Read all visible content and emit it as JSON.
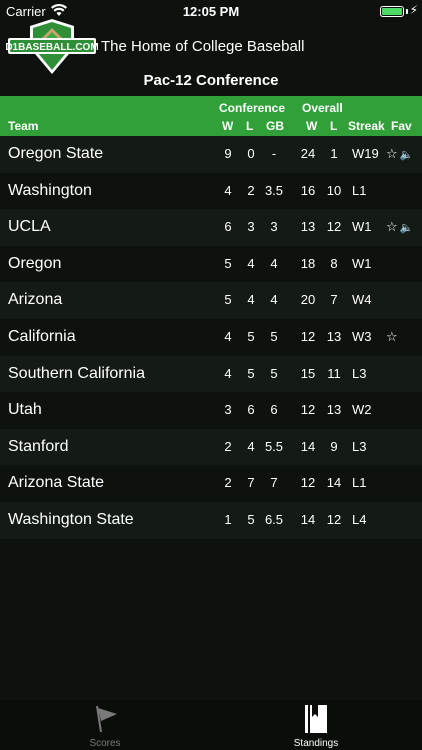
{
  "status_bar": {
    "carrier": "Carrier",
    "time": "12:05 PM",
    "battery_level": 1.0
  },
  "header": {
    "logo_text": "D1BASEBALL.COM",
    "tagline": "The Home of College Baseball",
    "conference_title": "Pac-12 Conference"
  },
  "columns": {
    "group_conference": "Conference",
    "group_overall": "Overall",
    "team": "Team",
    "conf_w": "W",
    "conf_l": "L",
    "gb": "GB",
    "overall_w": "W",
    "overall_l": "L",
    "streak": "Streak",
    "fav": "Fav"
  },
  "standings": [
    {
      "team": "Oregon State",
      "cw": "9",
      "cl": "0",
      "gb": "-",
      "ow": "24",
      "ol": "1",
      "streak": "W19",
      "star": "☆",
      "speaker": "🔈"
    },
    {
      "team": "Washington",
      "cw": "4",
      "cl": "2",
      "gb": "3.5",
      "ow": "16",
      "ol": "10",
      "streak": "L1",
      "star": "",
      "speaker": ""
    },
    {
      "team": "UCLA",
      "cw": "6",
      "cl": "3",
      "gb": "3",
      "ow": "13",
      "ol": "12",
      "streak": "W1",
      "star": "☆",
      "speaker": "🔈"
    },
    {
      "team": "Oregon",
      "cw": "5",
      "cl": "4",
      "gb": "4",
      "ow": "18",
      "ol": "8",
      "streak": "W1",
      "star": "",
      "speaker": ""
    },
    {
      "team": "Arizona",
      "cw": "5",
      "cl": "4",
      "gb": "4",
      "ow": "20",
      "ol": "7",
      "streak": "W4",
      "star": "",
      "speaker": ""
    },
    {
      "team": "California",
      "cw": "4",
      "cl": "5",
      "gb": "5",
      "ow": "12",
      "ol": "13",
      "streak": "W3",
      "star": "☆",
      "speaker": ""
    },
    {
      "team": "Southern California",
      "cw": "4",
      "cl": "5",
      "gb": "5",
      "ow": "15",
      "ol": "11",
      "streak": "L3",
      "star": "",
      "speaker": ""
    },
    {
      "team": "Utah",
      "cw": "3",
      "cl": "6",
      "gb": "6",
      "ow": "12",
      "ol": "13",
      "streak": "W2",
      "star": "",
      "speaker": ""
    },
    {
      "team": "Stanford",
      "cw": "2",
      "cl": "4",
      "gb": "5.5",
      "ow": "14",
      "ol": "9",
      "streak": "L3",
      "star": "",
      "speaker": ""
    },
    {
      "team": "Arizona State",
      "cw": "2",
      "cl": "7",
      "gb": "7",
      "ow": "12",
      "ol": "14",
      "streak": "L1",
      "star": "",
      "speaker": ""
    },
    {
      "team": "Washington State",
      "cw": "1",
      "cl": "5",
      "gb": "6.5",
      "ow": "14",
      "ol": "12",
      "streak": "L4",
      "star": "",
      "speaker": ""
    }
  ],
  "tab_bar": {
    "scores": {
      "label": "Scores",
      "icon": "pennant-icon"
    },
    "standings": {
      "label": "Standings",
      "icon": "standings-icon"
    }
  },
  "colors": {
    "background": "#0e120e",
    "header_green": "#31a039",
    "battery": "#4cd964",
    "tab_inactive": "#7a7a7a"
  }
}
